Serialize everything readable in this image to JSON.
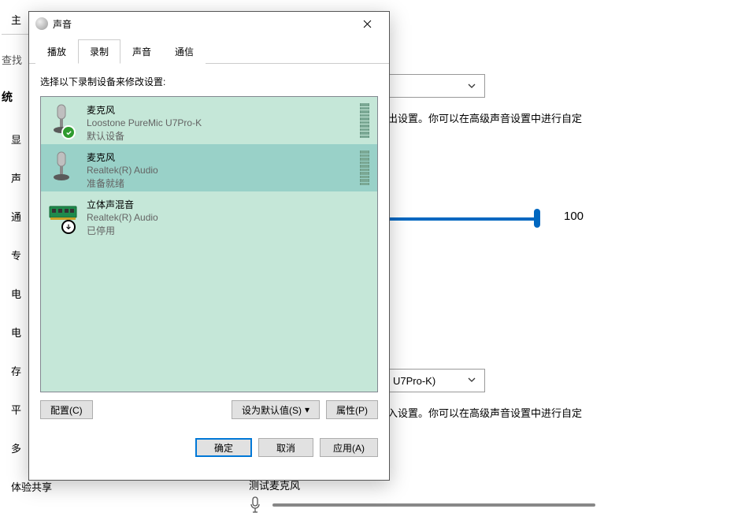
{
  "bg": {
    "sidebar": {
      "home": "主",
      "search": "查找",
      "heading": "统",
      "items": [
        "显",
        "声",
        "通",
        "专",
        "电",
        "电",
        "存",
        "平",
        "多",
        "体验共享"
      ]
    },
    "out_text": "出设置。你可以在高级声音设置中进行自定",
    "volume_value": "100",
    "input_device": "U7Pro-K)",
    "in_text": "入设置。你可以在高级声音设置中进行自定",
    "test_mic": "测试麦克风"
  },
  "dialog": {
    "title": "声音",
    "tabs": [
      "播放",
      "录制",
      "声音",
      "通信"
    ],
    "active_tab_index": 1,
    "instruction": "选择以下录制设备来修改设置:",
    "devices": [
      {
        "name": "麦克风",
        "desc": "Loostone PureMic U7Pro-K",
        "status": "默认设备",
        "icon": "mic",
        "badge": "check",
        "has_meter": true,
        "selected": false
      },
      {
        "name": "麦克风",
        "desc": "Realtek(R) Audio",
        "status": "准备就绪",
        "icon": "mic",
        "badge": null,
        "has_meter": true,
        "selected": true
      },
      {
        "name": "立体声混音",
        "desc": "Realtek(R) Audio",
        "status": "已停用",
        "icon": "pcb",
        "badge": "down",
        "has_meter": false,
        "selected": false
      }
    ],
    "buttons": {
      "configure": "配置(C)",
      "set_default": "设为默认值(S)",
      "properties": "属性(P)",
      "ok": "确定",
      "cancel": "取消",
      "apply": "应用(A)"
    }
  }
}
